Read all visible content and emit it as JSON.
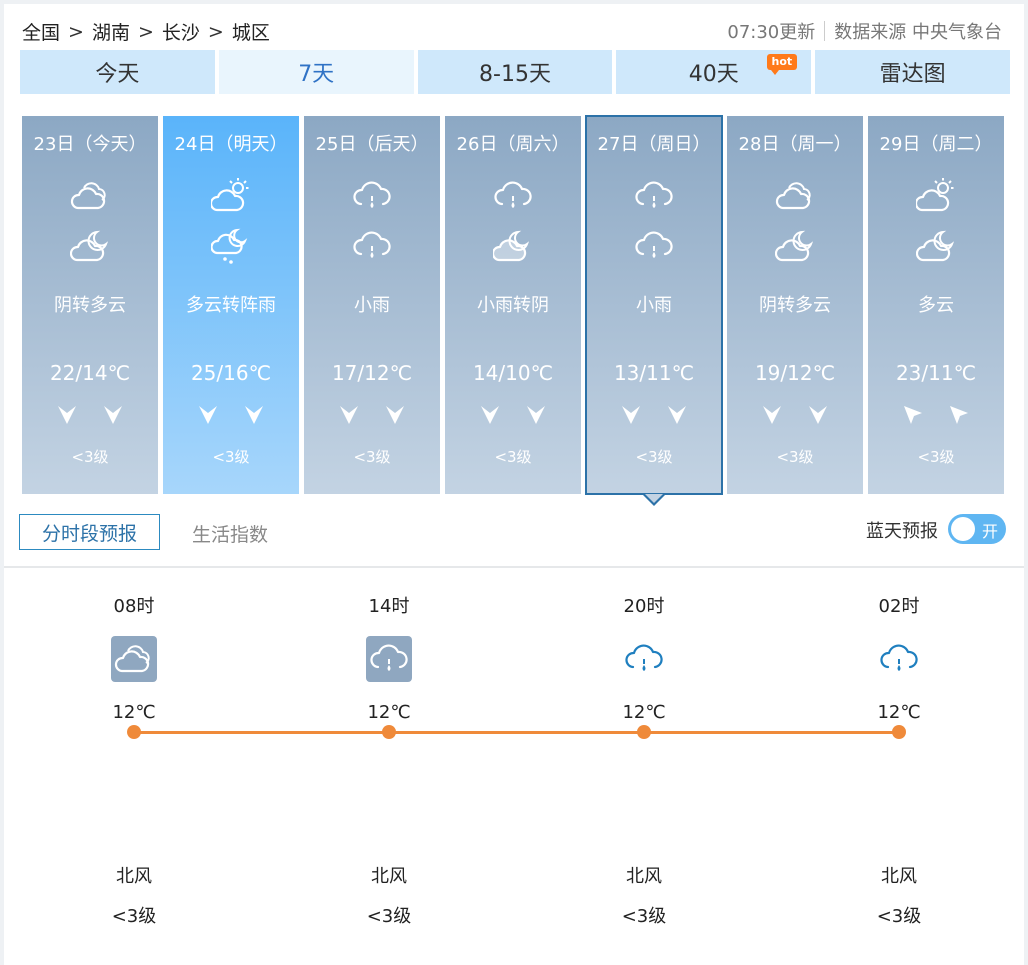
{
  "breadcrumb": {
    "items": [
      "全国",
      "湖南",
      "长沙",
      "城区"
    ],
    "separator": ">"
  },
  "meta": {
    "updated": "07:30更新",
    "source": "数据来源 中央气象台"
  },
  "tabs": [
    {
      "label": "今天"
    },
    {
      "label": "7天"
    },
    {
      "label": "8-15天"
    },
    {
      "label": "40天",
      "badge": "hot"
    },
    {
      "label": "雷达图"
    }
  ],
  "days": [
    {
      "date": "23日（今天）",
      "icon_day": "cloudy-icon",
      "icon_night": "partly-cloudy-night-icon",
      "desc": "阴转多云",
      "temp": "22/14℃",
      "wind_icon": "wind-north-icon",
      "level": "<3级"
    },
    {
      "date": "24日（明天）",
      "icon_day": "partly-cloudy-day-icon",
      "icon_night": "shower-night-icon",
      "desc": "多云转阵雨",
      "temp": "25/16℃",
      "wind_icon": "wind-north-icon",
      "level": "<3级"
    },
    {
      "date": "25日（后天）",
      "icon_day": "light-rain-icon",
      "icon_night": "light-rain-icon",
      "desc": "小雨",
      "temp": "17/12℃",
      "wind_icon": "wind-north-icon",
      "level": "<3级"
    },
    {
      "date": "26日（周六）",
      "icon_day": "light-rain-icon",
      "icon_night": "cloudy-night-icon",
      "desc": "小雨转阴",
      "temp": "14/10℃",
      "wind_icon": "wind-north-icon",
      "level": "<3级"
    },
    {
      "date": "27日（周日）",
      "icon_day": "light-rain-icon",
      "icon_night": "light-rain-icon",
      "desc": "小雨",
      "temp": "13/11℃",
      "wind_icon": "wind-north-icon",
      "level": "<3级"
    },
    {
      "date": "28日（周一）",
      "icon_day": "cloudy-icon",
      "icon_night": "partly-cloudy-night-icon",
      "desc": "阴转多云",
      "temp": "19/12℃",
      "wind_icon": "wind-north-icon",
      "level": "<3级"
    },
    {
      "date": "29日（周二）",
      "icon_day": "partly-cloudy-day-icon",
      "icon_night": "partly-cloudy-night-icon",
      "desc": "多云",
      "temp": "23/11℃",
      "wind_icon": "wind-southeast-icon",
      "level": "<3级"
    }
  ],
  "subtabs": {
    "hourly": "分时段预报",
    "life": "生活指数"
  },
  "bluesky": {
    "label": "蓝天预报",
    "toggle_text": "开"
  },
  "hourly": [
    {
      "time": "08时",
      "icon": "cloudy-icon",
      "temp": "12℃",
      "wind_dir": "北风",
      "wind_level": "<3级"
    },
    {
      "time": "14时",
      "icon": "light-rain-icon",
      "temp": "12℃",
      "wind_dir": "北风",
      "wind_level": "<3级"
    },
    {
      "time": "20时",
      "icon": "light-rain-icon",
      "temp": "12℃",
      "wind_dir": "北风",
      "wind_level": "<3级"
    },
    {
      "time": "02时",
      "icon": "light-rain-icon",
      "temp": "12℃",
      "wind_dir": "北风",
      "wind_level": "<3级"
    }
  ],
  "colors": {
    "accent": "#2f72c5",
    "tab_bg": "#cfe8fb",
    "temp_line": "#ef8a3a",
    "toggle": "#5fb6f2"
  }
}
